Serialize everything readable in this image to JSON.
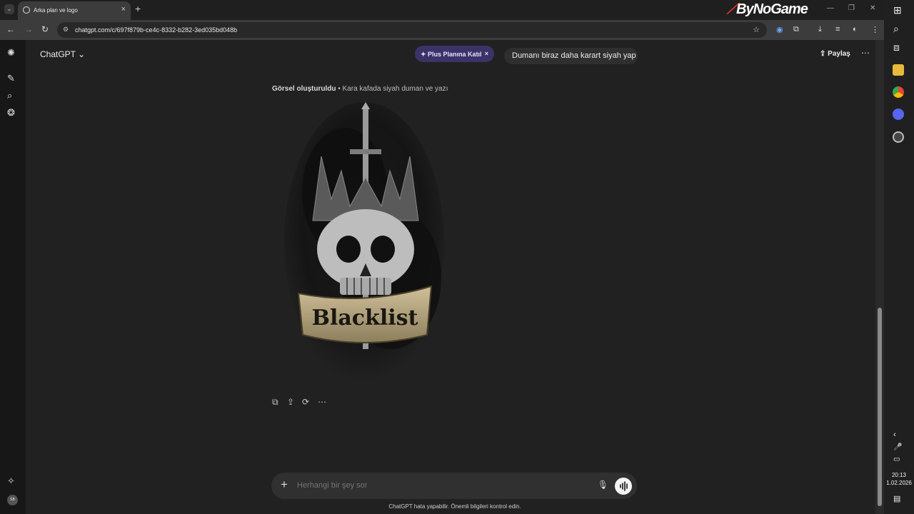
{
  "browser": {
    "tab_title": "Arka plan ve logo",
    "url": "chatgpt.com/c/697f879b-ce4c-8332-b282-3ed035bd048b",
    "brand_logo_text": "ByNoGame"
  },
  "app": {
    "name": "ChatGPT",
    "plus_badge": "✦ Plus Planına Katıl",
    "share_label": "Paylaş",
    "user_prompt": "Dumanı biraz daha karart siyah yap"
  },
  "message": {
    "generated_label": "Görsel oluşturuldu",
    "generated_caption": " • Kara kafada siyah duman ve yazı",
    "image_text": "Blacklist"
  },
  "composer": {
    "placeholder": "Herhangi bir şey sor",
    "disclaimer": "ChatGPT hata yapabilir. Önemli bilgileri kontrol edin."
  },
  "avatar_initials": "SB",
  "system": {
    "time": "20:13",
    "date": "1.02.2026"
  },
  "colors": {
    "background": "#212121",
    "sidebar": "#171717",
    "plus_badge_bg": "#3b3368",
    "brand_red": "#e0342a"
  }
}
